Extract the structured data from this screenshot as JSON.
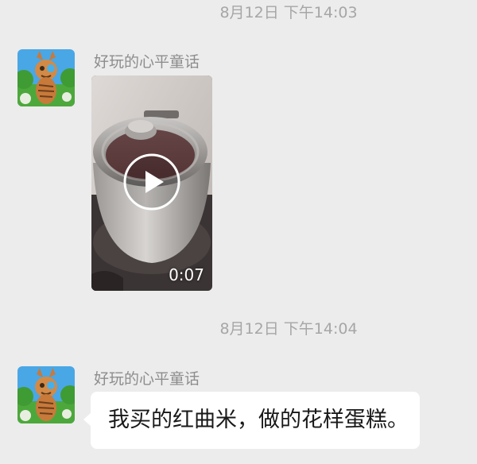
{
  "messages": [
    {
      "timestamp": "8月12日 下午14:03",
      "sender": "好玩的心平童话",
      "avatar_icon": "tiger-avatar-icon",
      "type": "video",
      "duration": "0:07"
    },
    {
      "timestamp": "8月12日 下午14:04",
      "sender": "好玩的心平童话",
      "avatar_icon": "tiger-avatar-icon",
      "type": "text",
      "text": "我买的红曲米，做的花样蛋糕。"
    }
  ],
  "colors": {
    "background": "#ececec",
    "bubble": "#ffffff",
    "timestamp": "#a6a6a6",
    "sender": "#8d8d8d",
    "message_text": "#191919"
  }
}
